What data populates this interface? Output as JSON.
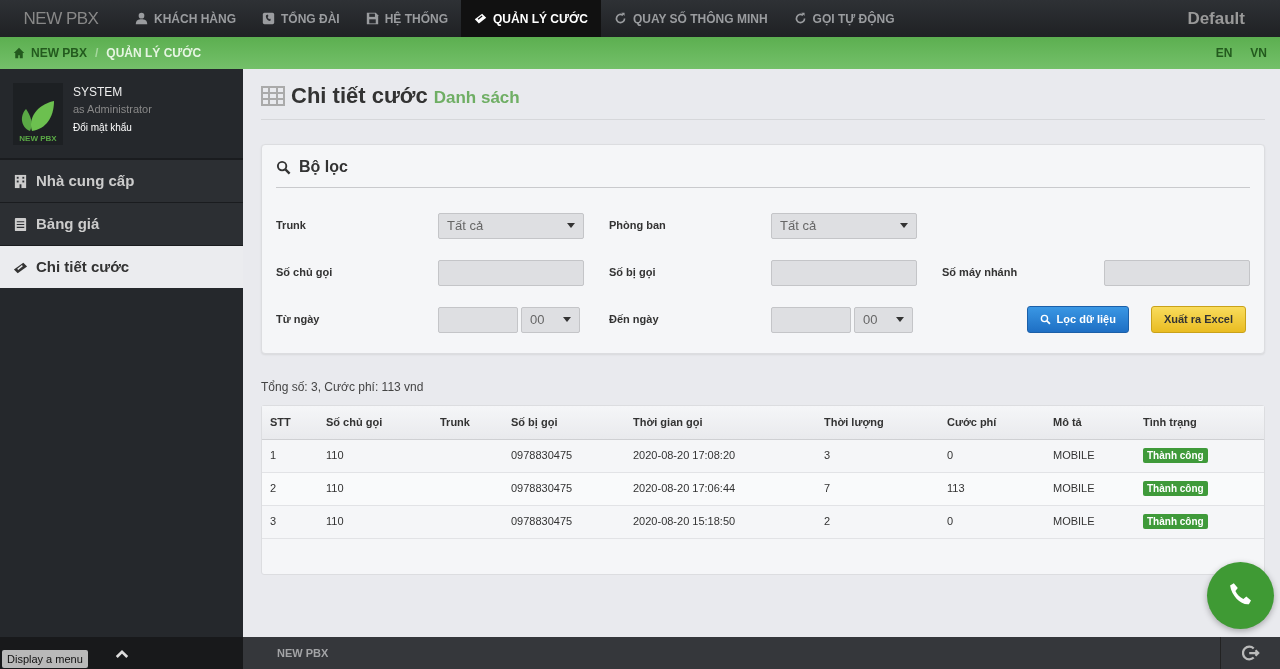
{
  "topnav": {
    "brand": "NEW PBX",
    "items": [
      {
        "label": "KHÁCH HÀNG",
        "selected": false
      },
      {
        "label": "TỔNG ĐÀI",
        "selected": false
      },
      {
        "label": "HỆ THỐNG",
        "selected": false
      },
      {
        "label": "QUẢN LÝ CƯỚC",
        "selected": true
      },
      {
        "label": "QUAY SỐ THÔNG MINH",
        "selected": false
      },
      {
        "label": "GỌI TỰ ĐỘNG",
        "selected": false
      }
    ],
    "profile": "Default"
  },
  "breadcrumb": {
    "items": [
      "NEW PBX",
      "QUẢN LÝ CƯỚC"
    ],
    "separator": "/",
    "languages": [
      "EN",
      "VN"
    ]
  },
  "sidebar": {
    "user": {
      "logo_text": "NEW PBX",
      "name": "SYSTEM",
      "role": "as Administrator",
      "link": "Đổi mật khẩu"
    },
    "items": [
      {
        "label": "Nhà cung cấp",
        "selected": false
      },
      {
        "label": "Bảng giá",
        "selected": false
      },
      {
        "label": "Chi tiết cước",
        "selected": true
      }
    ],
    "tooltip": "Display a menu"
  },
  "page": {
    "title": "Chi tiết cước",
    "subtitle": "Danh sách"
  },
  "filter": {
    "title": "Bộ lọc",
    "rows": [
      [
        {
          "label": "Trunk",
          "kind": "select",
          "value": "Tất cả"
        },
        {
          "label": "Phòng ban",
          "kind": "select",
          "value": "Tất cả"
        }
      ],
      [
        {
          "label": "Số chủ gọi",
          "kind": "input"
        },
        {
          "label": "Số bị gọi",
          "kind": "input"
        },
        {
          "label": "Số máy nhánh",
          "kind": "input"
        }
      ],
      [
        {
          "label": "Từ ngày",
          "kind": "date",
          "hour": "00"
        },
        {
          "label": "Đến ngày",
          "kind": "date",
          "hour": "00"
        }
      ]
    ],
    "buttons": [
      {
        "label": "Lọc dữ liệu",
        "kind": "primary"
      },
      {
        "label": "Xuất ra Excel",
        "kind": "warning"
      }
    ]
  },
  "summary": "Tổng số: 3, Cước phí: 113 vnd",
  "table": {
    "columns": [
      "STT",
      "Số chủ gọi",
      "Trunk",
      "Số bị gọi",
      "Thời gian gọi",
      "Thời lượng",
      "Cước phí",
      "Mô tả",
      "Tình trạng"
    ],
    "rows": [
      {
        "cells": [
          "1",
          "110",
          "",
          "0978830475",
          "2020-08-20 17:08:20",
          "3",
          "0",
          "MOBILE"
        ],
        "status": "Thành công",
        "color": "#3f9a3a"
      },
      {
        "cells": [
          "2",
          "110",
          "",
          "0978830475",
          "2020-08-20 17:06:44",
          "7",
          "113",
          "MOBILE"
        ],
        "status": "Thành công",
        "color": "#3f9a3a"
      },
      {
        "cells": [
          "3",
          "110",
          "",
          "0978830475",
          "2020-08-20 15:18:50",
          "2",
          "0",
          "MOBILE"
        ],
        "status": "Thành công",
        "color": "#3f9a3a"
      }
    ]
  },
  "footer": {
    "brand": "NEW PBX"
  }
}
